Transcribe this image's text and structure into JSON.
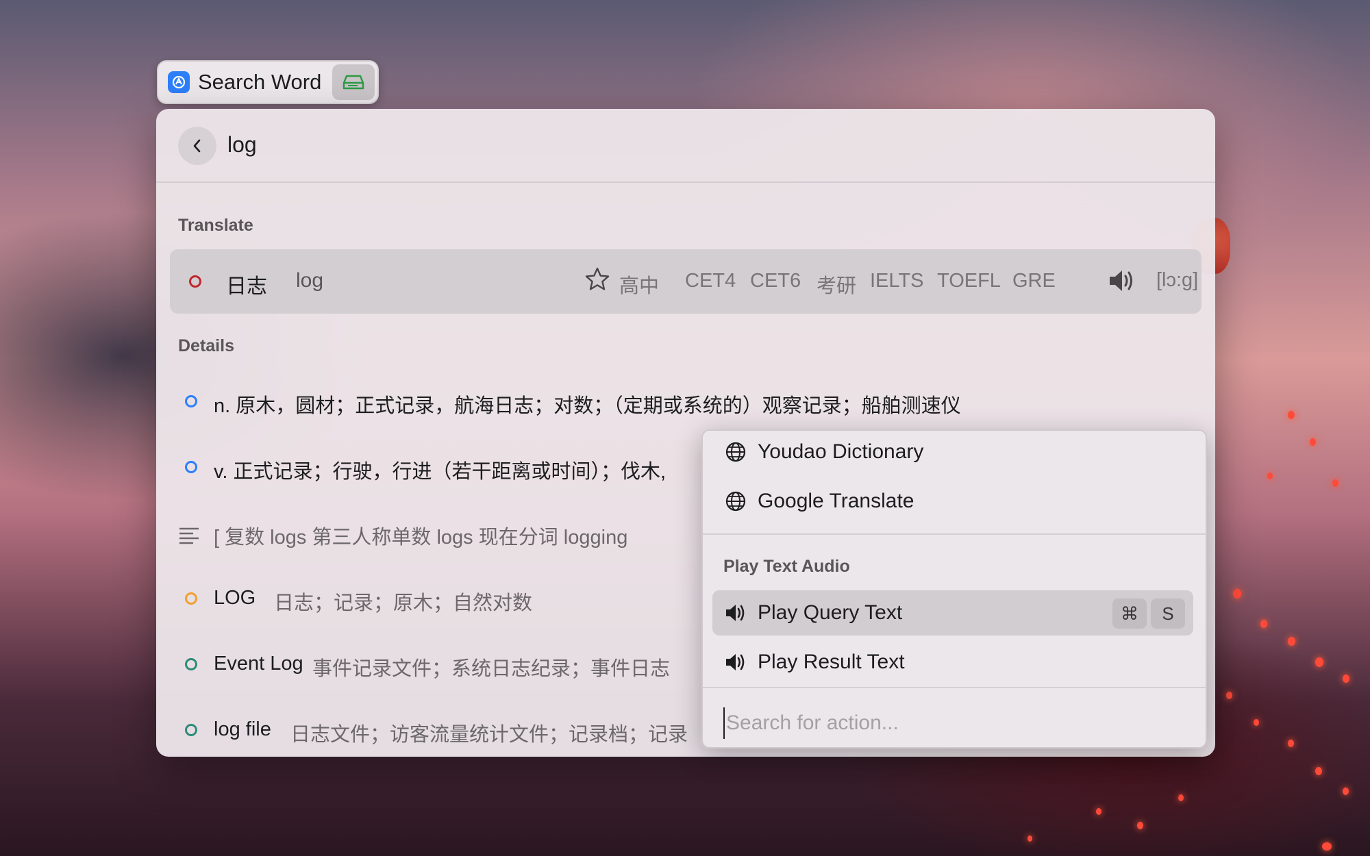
{
  "command": {
    "title": "Search Word",
    "app_icon": "translate-app-icon",
    "secondary_icon": "drive-icon"
  },
  "search": {
    "query": "log"
  },
  "sections": {
    "translate": "Translate",
    "details": "Details"
  },
  "translate_result": {
    "main": "日志",
    "sub": "log",
    "tags": [
      "高中",
      "CET4",
      "CET6",
      "考研",
      "IELTS",
      "TOEFL",
      "GRE"
    ],
    "phonetic": "[lɔ:g]",
    "dot_color": "#c0272d"
  },
  "details": [
    {
      "lead": "",
      "text": "n. 原木，圆材；正式记录，航海日志；对数；（定期或系统的）观察记录；船舶测速仪",
      "muted": "",
      "dot_color": "#2d7ff9"
    },
    {
      "lead": "",
      "text": "v. 正式记录；行驶，行进（若干距离或时间）；伐木,",
      "muted": "",
      "dot_color": "#2d7ff9"
    },
    {
      "lead": "",
      "text": "[ 复数 logs   第三人称单数 logs   现在分词 logging",
      "muted": "",
      "dot_color": ""
    },
    {
      "lead": "LOG",
      "text": "",
      "muted": "日志；记录；原木；自然对数",
      "dot_color": "#f0a030"
    },
    {
      "lead": "Event Log",
      "text": "",
      "muted": "事件记录文件；系统日志纪录；事件日志",
      "dot_color": "#2e8b7a"
    },
    {
      "lead": "log file",
      "text": "",
      "muted": "日志文件；访客流量统计文件；记录档；记录",
      "dot_color": "#2e8b7a"
    }
  ],
  "actions": {
    "items": [
      {
        "label": "Youdao Dictionary",
        "icon": "globe-icon"
      },
      {
        "label": "Google Translate",
        "icon": "globe-icon"
      }
    ],
    "audio_section": "Play Text Audio",
    "audio_items": [
      {
        "label": "Play Query Text",
        "icon": "speaker-icon",
        "shortcut": [
          "⌘",
          "S"
        ]
      },
      {
        "label": "Play Result Text",
        "icon": "speaker-icon"
      }
    ],
    "search_placeholder": "Search for action..."
  }
}
